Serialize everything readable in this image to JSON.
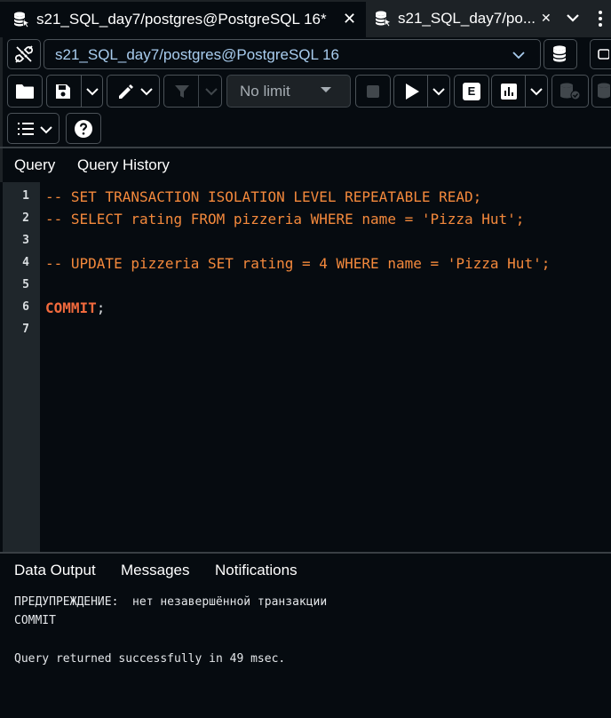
{
  "tabs": [
    {
      "label": "s21_SQL_day7/postgres@PostgreSQL 16*",
      "active": true
    },
    {
      "label": "s21_SQL_day7/po...",
      "active": false
    }
  ],
  "connection": {
    "label": "s21_SQL_day7/postgres@PostgreSQL 16"
  },
  "toolbar": {
    "limit_label": "No limit",
    "explain_label": "E"
  },
  "query_tabs": [
    "Query",
    "Query History"
  ],
  "editor": {
    "line_numbers": [
      "1",
      "2",
      "3",
      "4",
      "5",
      "6",
      "7"
    ],
    "lines": [
      "-- SET TRANSACTION ISOLATION LEVEL REPEATABLE READ;",
      "-- SELECT rating FROM pizzeria WHERE name = 'Pizza Hut';",
      "",
      "-- UPDATE pizzeria SET rating = 4 WHERE name = 'Pizza Hut';",
      "",
      "COMMIT",
      ""
    ],
    "line6_punct": ";"
  },
  "result_tabs": [
    "Data Output",
    "Messages",
    "Notifications"
  ],
  "messages": [
    "ПРЕДУПРЕЖДЕНИЕ:  нет незавершённой транзакции",
    "COMMIT",
    "",
    "Query returned successfully in 49 msec."
  ],
  "colors": {
    "background": "#060b10",
    "comment": "#f4893c",
    "keyword": "#f26a3d",
    "connection_text": "#a9cdef"
  }
}
